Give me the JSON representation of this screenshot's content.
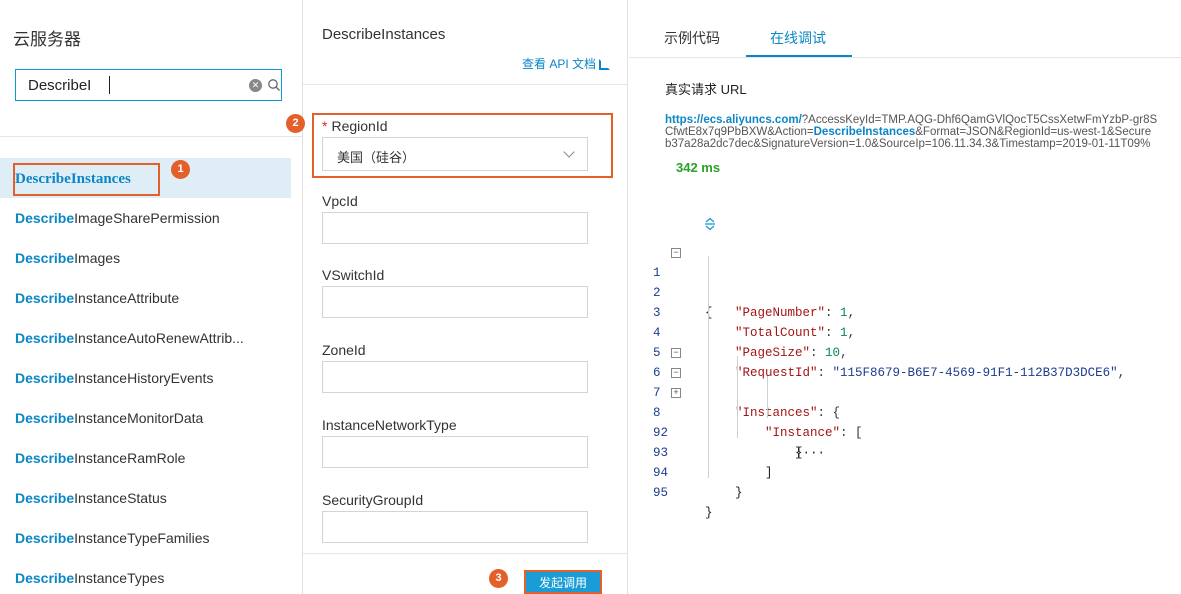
{
  "left": {
    "title": "云服务器",
    "search_value": "DescribeI",
    "search_highlight": "Describe",
    "items": [
      {
        "rest": "Instances",
        "active": true
      },
      {
        "rest": "ImageSharePermission"
      },
      {
        "rest": "Images"
      },
      {
        "rest": "InstanceAttribute"
      },
      {
        "rest": "InstanceAutoRenewAttrib..."
      },
      {
        "rest": "InstanceHistoryEvents"
      },
      {
        "rest": "InstanceMonitorData"
      },
      {
        "rest": "InstanceRamRole"
      },
      {
        "rest": "InstanceStatus"
      },
      {
        "rest": "InstanceTypeFamilies"
      },
      {
        "rest": "InstanceTypes"
      }
    ],
    "badge": "1"
  },
  "middle": {
    "api_name": "DescribeInstances",
    "doc_link": "查看 API 文档",
    "badge": "2",
    "region": {
      "required_mark": "*",
      "label": "RegionId",
      "value": "美国（硅谷）"
    },
    "fields": [
      {
        "label": "VpcId"
      },
      {
        "label": "VSwitchId"
      },
      {
        "label": "ZoneId"
      },
      {
        "label": "InstanceNetworkType"
      },
      {
        "label": "SecurityGroupId"
      }
    ],
    "invoke_badge": "3",
    "invoke_label": "发起调用"
  },
  "right": {
    "tabs": [
      {
        "label": "示例代码"
      },
      {
        "label": "在线调试",
        "active": true
      }
    ],
    "request_title": "真实请求 URL",
    "url": {
      "host": "https://ecs.aliyuncs.com/",
      "line1_rest": "?AccessKeyId=TMP.AQG-Dhf6QamGVlQocT5CssXetwFmYzbP-gr8S",
      "line2_pre": "CfwtE8x7q9PbBXW&Action=",
      "line2_action": "DescribeInstances",
      "line2_post": "&Format=JSON&RegionId=us-west-1&Secure",
      "line3": "b37a28a2dc7dec&SignatureVersion=1.0&SourceIp=106.11.34.3&Timestamp=2019-01-11T09%"
    },
    "latency": "342 ms",
    "code_lines": [
      {
        "ln": "1",
        "fold": "−"
      },
      {
        "ln": "2",
        "key": "\"PageNumber\"",
        "val": "1"
      },
      {
        "ln": "3",
        "key": "\"TotalCount\"",
        "val": "1"
      },
      {
        "ln": "4",
        "key": "\"PageSize\"",
        "val": "10"
      },
      {
        "ln": "5",
        "key": "\"RequestId\"",
        "val": "\"115F8679-B6E7-4569-91F1-112B37D3DCE6\""
      },
      {
        "ln": "6",
        "fold": "−",
        "key": "\"Instances\""
      },
      {
        "ln": "7",
        "fold": "−",
        "key": "\"Instance\""
      },
      {
        "ln": "8",
        "fold": "+"
      },
      {
        "ln": "92"
      },
      {
        "ln": "93"
      },
      {
        "ln": "94"
      },
      {
        "ln": "95"
      }
    ]
  },
  "colors": {
    "accent": "#0b86c6",
    "highlight_box": "#e3602a",
    "button": "#1a9cd6",
    "latency": "#2aa12a"
  }
}
